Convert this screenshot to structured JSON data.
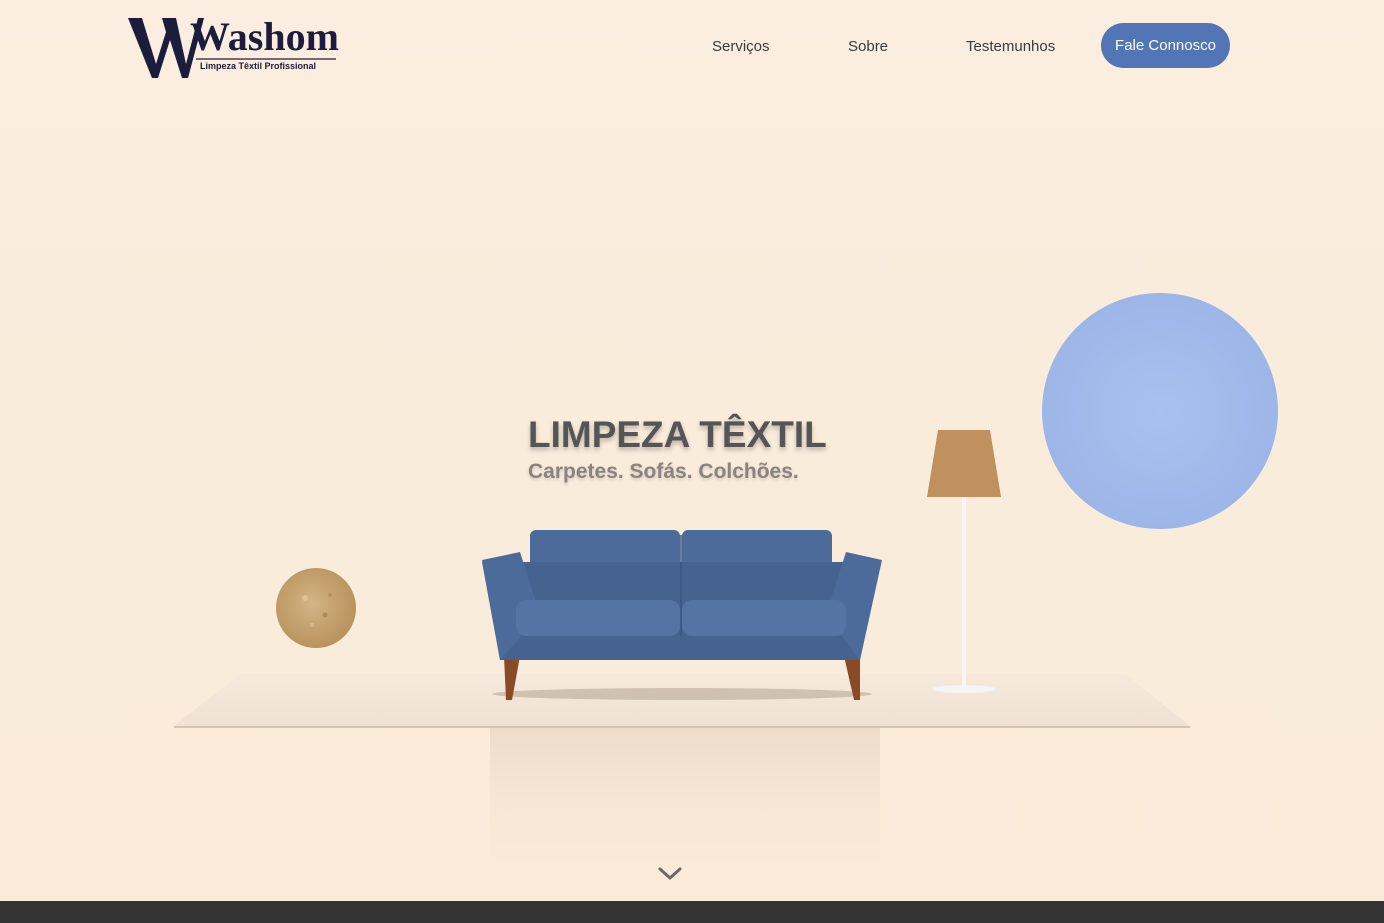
{
  "header": {
    "logo": {
      "brand": "Washome",
      "tagline": "Limpeza Têxtil Profissional"
    },
    "nav": [
      {
        "label": "Serviços"
      },
      {
        "label": "Sobre"
      },
      {
        "label": "Testemunhos"
      }
    ],
    "cta_label": "Fale Connosco"
  },
  "hero": {
    "title": "LIMPEZA TÊXTIL",
    "subtitle": "Carpetes. Sofás. Colchões."
  },
  "scene": {
    "sofa_color": "#4a6795",
    "lamp_shade_color": "#c19060",
    "fabric_circle_color": "#a4bdec",
    "carpet_sample_color": "#c9a775",
    "icons": [
      "chevron-down-icon"
    ]
  },
  "colors": {
    "accent": "#5275b6",
    "background": "#fbeddc",
    "footer": "#333333"
  }
}
